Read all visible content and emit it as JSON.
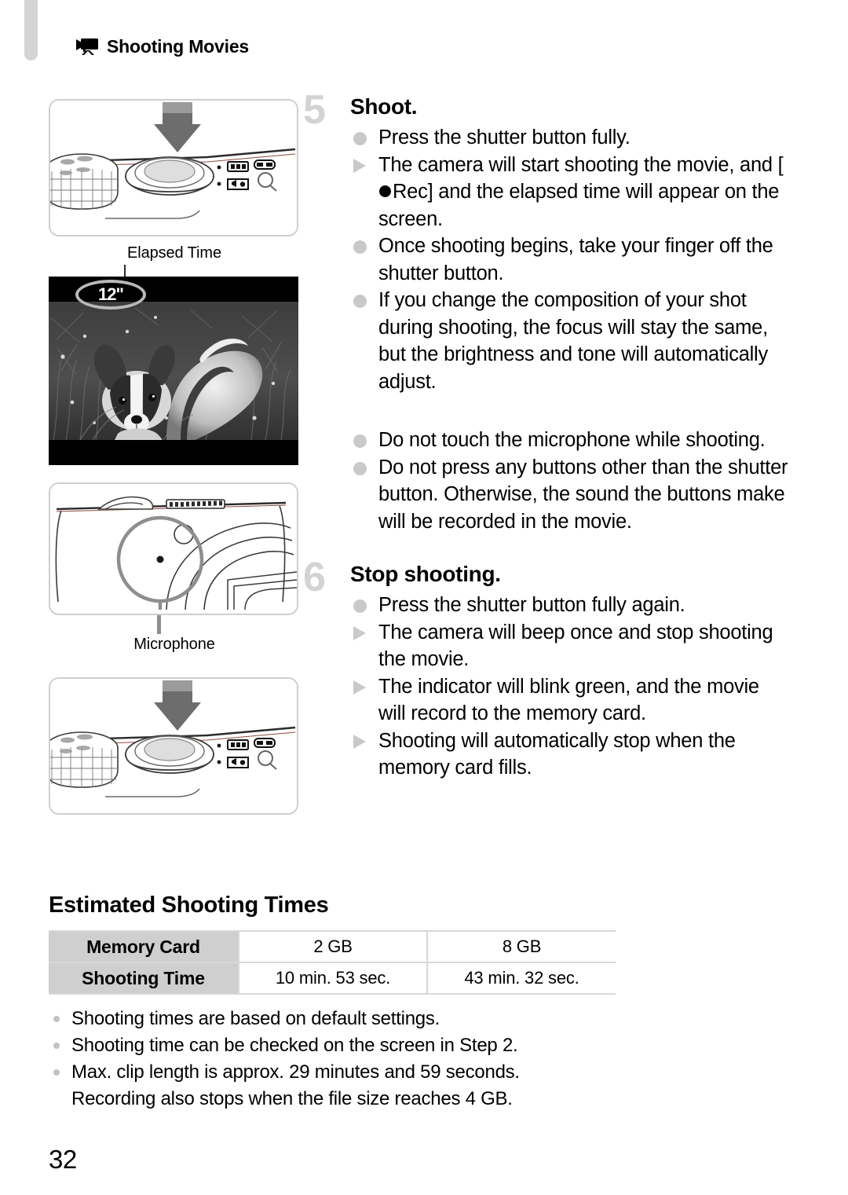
{
  "header": {
    "icon": "movie-camera-icon",
    "title": "Shooting Movies"
  },
  "figures": {
    "shutter_press_top": {
      "alt": "camera-top-shutter-button-press",
      "arrow": "down-arrow"
    },
    "screen": {
      "caption_top": "Elapsed Time",
      "elapsed_value": "12\"",
      "alt": "lcd-screen-dog-in-grass"
    },
    "microphone": {
      "caption": "Microphone",
      "alt": "camera-front-microphone-location"
    },
    "shutter_press_bottom": {
      "alt": "camera-top-shutter-button-press",
      "arrow": "down-arrow"
    }
  },
  "steps": [
    {
      "number": "5",
      "title": "Shoot.",
      "items": [
        {
          "marker": "dot",
          "text": "Press the shutter button fully."
        },
        {
          "marker": "tri",
          "text_pre": "The camera will start shooting the movie, and [",
          "rec_label": "Rec] and the elapsed time will appear on the screen."
        },
        {
          "marker": "dot",
          "text": "Once shooting begins, take your finger off the shutter button."
        },
        {
          "marker": "dot",
          "text": "If you change the composition of your shot during shooting, the focus will stay the same, but the brightness and tone will automatically adjust."
        }
      ]
    },
    {
      "number": "6",
      "title": "Stop shooting.",
      "items": [
        {
          "marker": "dot",
          "text": "Press the shutter button fully again."
        },
        {
          "marker": "tri",
          "text": "The camera will beep once and stop shooting the movie."
        },
        {
          "marker": "tri",
          "text": "The indicator will blink green, and the movie will record to the memory card."
        },
        {
          "marker": "tri",
          "text": "Shooting will automatically stop when the memory card fills."
        }
      ]
    }
  ],
  "mid_notes": [
    {
      "marker": "dot",
      "text": "Do not touch the microphone while shooting."
    },
    {
      "marker": "dot",
      "text": "Do not press any buttons other than the shutter button. Otherwise, the sound the buttons make will be recorded in the movie."
    }
  ],
  "table_section": {
    "title": "Estimated Shooting Times",
    "rows": [
      {
        "head": "Memory Card",
        "cells": [
          "2 GB",
          "8 GB"
        ]
      },
      {
        "head": "Shooting Time",
        "cells": [
          "10 min. 53 sec.",
          "43 min. 32 sec."
        ]
      }
    ],
    "notes": [
      "Shooting times are based on default settings.",
      "Shooting time can be checked on the screen in Step 2.",
      "Max. clip length is approx. 29 minutes and 59 seconds.",
      "Recording also stops when the file size reaches 4 GB."
    ]
  },
  "page_number": "32",
  "colors": {
    "marker_gray": "#c9c9c9",
    "step_number_gray": "#d3d3d3",
    "table_head_gray": "#cfcfcf"
  }
}
